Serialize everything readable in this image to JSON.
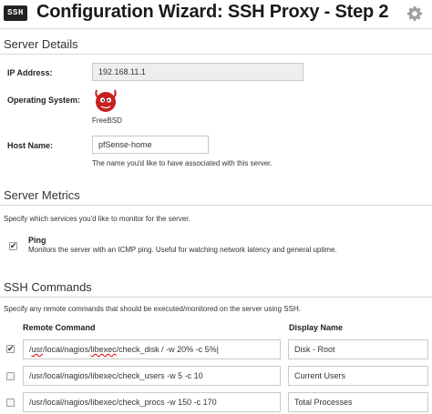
{
  "header": {
    "logo_text": "SSH",
    "title": "Configuration Wizard: SSH Proxy - Step 2",
    "settings_icon": "gear-icon"
  },
  "server_details": {
    "heading": "Server Details",
    "ip_label": "IP Address:",
    "ip_value": "192.168.11.1",
    "os_label": "Operating System:",
    "os_icon": "freebsd-daemon-icon",
    "os_name": "FreeBSD",
    "host_label": "Host Name:",
    "host_value": "pfSense-home",
    "host_help": "The name you'd like to have associated with this server."
  },
  "server_metrics": {
    "heading": "Server Metrics",
    "description": "Specify which services you'd like to monitor for the server.",
    "ping": {
      "label": "Ping",
      "checked": true,
      "description": "Monitors the server with an ICMP ping.  Useful for watching network latency and general uptime."
    }
  },
  "ssh_commands": {
    "heading": "SSH Commands",
    "description": "Specify any remote commands that should be executed/monitored on the server using SSH.",
    "col_command": "Remote Command",
    "col_display": "Display Name",
    "rows": [
      {
        "checked": true,
        "command": "/usr/local/nagios/libexec/check_disk / -w 20% -c 5%",
        "display": "Disk - Root"
      },
      {
        "checked": false,
        "command": "/usr/local/nagios/libexec/check_users -w 5 -c 10",
        "display": "Current Users"
      },
      {
        "checked": false,
        "command": "/usr/local/nagios/libexec/check_procs -w 150 -c 170",
        "display": "Total Processes"
      }
    ]
  },
  "colors": {
    "rule": "#d8d8d8",
    "readonly_bg": "#eeeeee",
    "os_icon_red": "#c81f1f"
  }
}
